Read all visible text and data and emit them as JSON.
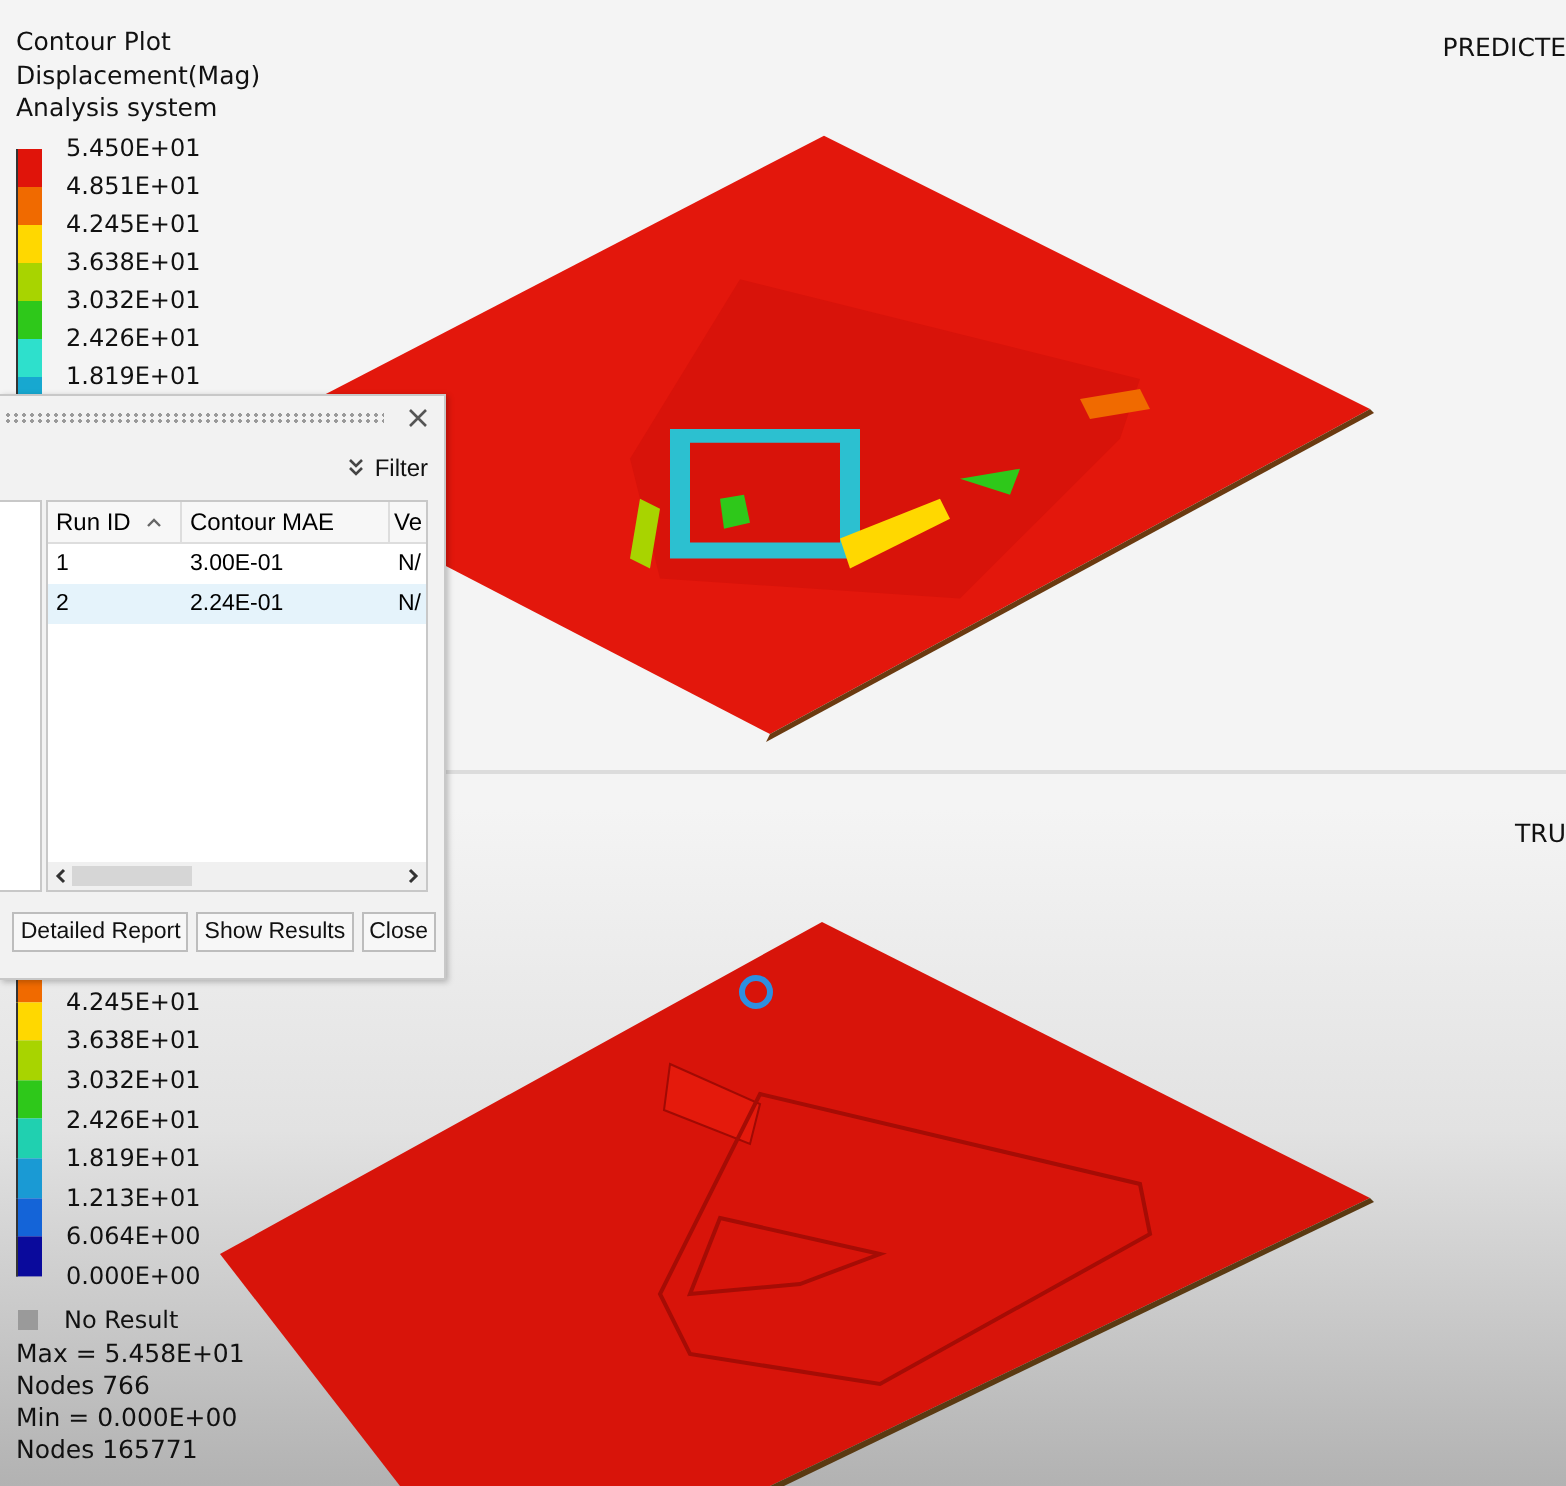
{
  "top_viewport": {
    "legend": {
      "title_lines": [
        "Contour Plot",
        "Displacement(Mag)",
        "Analysis system"
      ],
      "entries": [
        {
          "label": "5.450E+01",
          "color": "#e0140a"
        },
        {
          "label": "4.851E+01",
          "color": "#f06a00"
        },
        {
          "label": "4.245E+01",
          "color": "#ffd800"
        },
        {
          "label": "3.638E+01",
          "color": "#a8d400"
        },
        {
          "label": "3.032E+01",
          "color": "#2ec81a"
        },
        {
          "label": "2.426E+01",
          "color": "#2ee0cc"
        },
        {
          "label": "1.819E+01",
          "color": "#17a8d0"
        }
      ]
    },
    "view_label": "PREDICTE"
  },
  "bottom_viewport": {
    "legend": {
      "entries": [
        {
          "label": "4.245E+01",
          "color": "#f06a00"
        },
        {
          "label": "3.638E+01",
          "color": "#ffd800"
        },
        {
          "label": "3.032E+01",
          "color": "#a8d400"
        },
        {
          "label": "2.426E+01",
          "color": "#2ec81a"
        },
        {
          "label": "1.819E+01",
          "color": "#20d0b0"
        },
        {
          "label": "1.213E+01",
          "color": "#1a9ad4"
        },
        {
          "label": "6.064E+00",
          "color": "#1464d8"
        },
        {
          "label": "0.000E+00",
          "color": "#0a0a9c"
        }
      ],
      "no_result": "No Result",
      "stats": [
        "Max =  5.458E+01",
        "Nodes 766",
        "Min =  0.000E+00",
        "Nodes 165771"
      ]
    },
    "view_label": "TRU"
  },
  "dialog": {
    "filter": "Filter",
    "columns": [
      {
        "label": "Run ID",
        "sorted": true
      },
      {
        "label": "Contour MAE",
        "sorted": false
      },
      {
        "label": "Ve",
        "sorted": false
      }
    ],
    "rows": [
      {
        "cells": [
          "1",
          "3.00E-01",
          "N/"
        ],
        "selected": false
      },
      {
        "cells": [
          "2",
          "2.24E-01",
          "N/"
        ],
        "selected": true
      }
    ],
    "buttons": [
      "Detailed Report",
      "Show Results",
      "Close"
    ]
  }
}
